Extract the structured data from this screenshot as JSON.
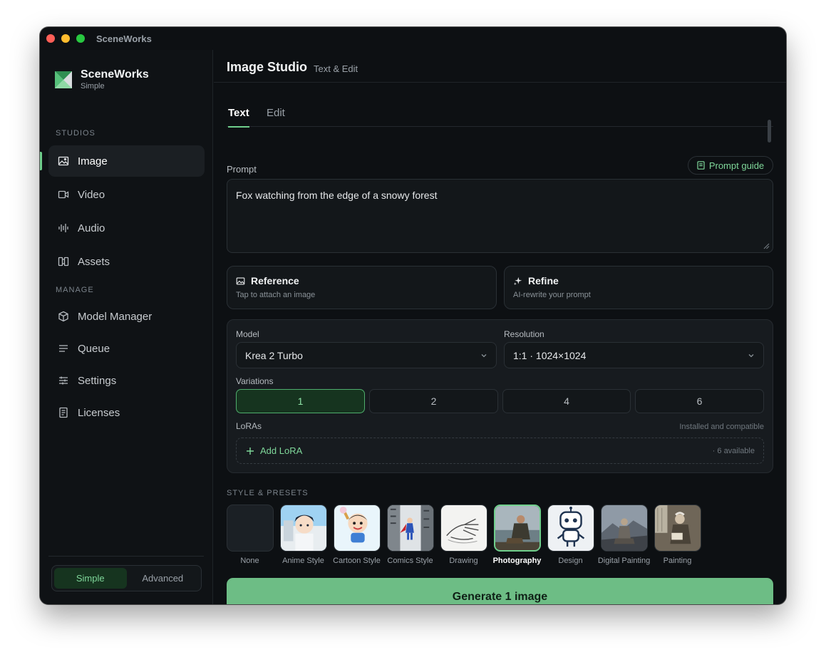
{
  "window": {
    "title": "SceneWorks"
  },
  "brand": {
    "name": "SceneWorks",
    "subtitle": "Simple"
  },
  "sidebar": {
    "studios_label": "STUDIOS",
    "studios": [
      {
        "label": "Image",
        "icon": "image-icon",
        "active": true
      },
      {
        "label": "Video",
        "icon": "video-icon"
      },
      {
        "label": "Audio",
        "icon": "audio-icon"
      },
      {
        "label": "Assets",
        "icon": "assets-icon"
      }
    ],
    "manage_label": "MANAGE",
    "manage": [
      {
        "label": "Model Manager",
        "icon": "cube-icon"
      },
      {
        "label": "Queue",
        "icon": "queue-icon"
      },
      {
        "label": "Settings",
        "icon": "sliders-icon"
      },
      {
        "label": "Licenses",
        "icon": "document-icon"
      }
    ],
    "mode": {
      "simple": "Simple",
      "advanced": "Advanced",
      "selected": "Simple"
    }
  },
  "header": {
    "title": "Image Studio",
    "subtitle": "Text & Edit"
  },
  "tabs": [
    {
      "label": "Text",
      "active": true
    },
    {
      "label": "Edit"
    }
  ],
  "prompt": {
    "label": "Prompt",
    "guide_label": "Prompt guide",
    "value": "Fox watching from the edge of a snowy forest"
  },
  "reference": {
    "title": "Reference",
    "subtitle": "Tap to attach an image"
  },
  "refine": {
    "title": "Refine",
    "subtitle": "AI-rewrite your prompt"
  },
  "settings": {
    "model_label": "Model",
    "model_value": "Krea 2 Turbo",
    "resolution_label": "Resolution",
    "resolution_value": "1:1 · 1024×1024",
    "variations_label": "Variations",
    "variations": [
      "1",
      "2",
      "4",
      "6"
    ],
    "variations_selected": "1",
    "loras_label": "LoRAs",
    "loras_hint": "Installed and compatible",
    "add_lora_label": "Add LoRA",
    "loras_available": "· 6 available"
  },
  "presets": {
    "label": "STYLE & PRESETS",
    "items": [
      "None",
      "Anime Style",
      "Cartoon Style",
      "Comics Style",
      "Drawing",
      "Photography",
      "Design",
      "Digital Painting",
      "Painting"
    ],
    "selected": "Photography"
  },
  "generate": {
    "label": "Generate 1 image"
  },
  "colors": {
    "accent": "#6fcf8c",
    "generate_bg": "#6dbd85",
    "background": "#0d1013"
  }
}
